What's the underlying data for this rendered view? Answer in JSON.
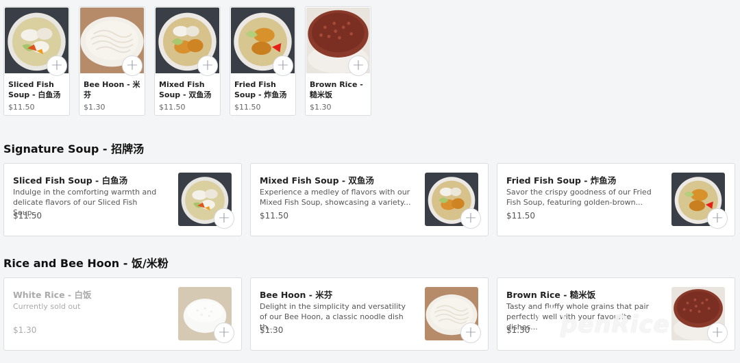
{
  "top_items": [
    {
      "name": "Sliced Fish Soup - 白鱼汤",
      "price": "$11.50",
      "img": "sliced"
    },
    {
      "name": "Bee Hoon - 米芬",
      "price": "$1.30",
      "img": "beehoon"
    },
    {
      "name": "Mixed Fish Soup - 双鱼汤",
      "price": "$11.50",
      "img": "mixed"
    },
    {
      "name": "Fried Fish Soup - 炸鱼汤",
      "price": "$11.50",
      "img": "fried"
    },
    {
      "name": "Brown Rice - 糙米饭",
      "price": "$1.30",
      "img": "brown"
    }
  ],
  "add_symbol": "+",
  "sections": [
    {
      "title": "Signature Soup - 招牌汤",
      "items": [
        {
          "name": "Sliced Fish Soup - 白鱼汤",
          "desc": "Indulge in the comforting warmth and delicate flavors of our Sliced Fish Soup...",
          "price": "$11.50",
          "img": "sliced",
          "sold_out": false
        },
        {
          "name": "Mixed Fish Soup - 双鱼汤",
          "desc": "Experience a medley of flavors with our Mixed Fish Soup, showcasing a variety...",
          "price": "$11.50",
          "img": "mixed",
          "sold_out": false
        },
        {
          "name": "Fried Fish Soup - 炸鱼汤",
          "desc": "Savor the crispy goodness of our Fried Fish Soup, featuring golden-brown...",
          "price": "$11.50",
          "img": "fried",
          "sold_out": false
        }
      ]
    },
    {
      "title": "Rice and Bee Hoon - 饭/米粉",
      "items": [
        {
          "name": "White Rice - 白饭",
          "desc": "Currently sold out",
          "price": "$1.30",
          "img": "white",
          "sold_out": true
        },
        {
          "name": "Bee Hoon - 米芬",
          "desc": "Delight in the simplicity and versatility of our Bee Hoon, a classic noodle dish th...",
          "price": "$1.30",
          "img": "beehoon",
          "sold_out": false
        },
        {
          "name": "Brown Rice - 糙米饭",
          "desc": "Tasty and fluffy whole grains that pair perfectly well with your favourite dishes...",
          "price": "$1.30",
          "img": "brown",
          "sold_out": false
        }
      ]
    }
  ],
  "watermark": "penRice"
}
